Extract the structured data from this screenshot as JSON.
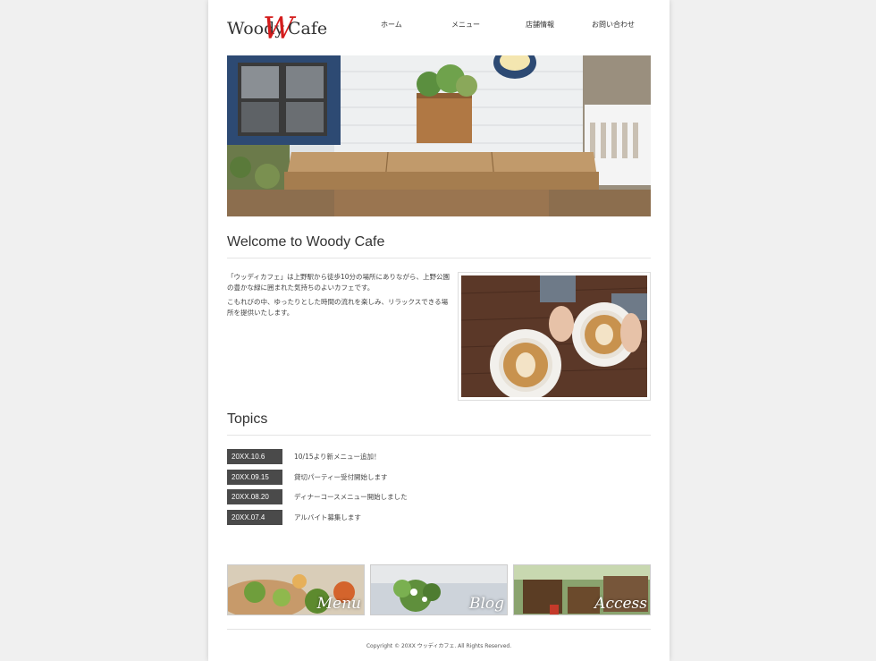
{
  "logo": {
    "part1": "Woody",
    "big_letter": "W",
    "part2": "Cafe"
  },
  "nav": [
    {
      "label": "ホーム"
    },
    {
      "label": "メニュー"
    },
    {
      "label": "店舗情報"
    },
    {
      "label": "お問い合わせ"
    }
  ],
  "welcome": {
    "title": "Welcome to Woody Cafe",
    "paragraphs": [
      "「ウッディカフェ」は上野駅から徒歩10分の場所にありながら、上野公園の豊かな緑に囲まれた気持ちのよいカフェです。",
      "こもれびの中、ゆったりとした時間の流れを楽しみ、リラックスできる場所を提供いたします。"
    ]
  },
  "topics": {
    "title": "Topics",
    "items": [
      {
        "date": "20XX.10.6",
        "text": "10/15より新メニュー追加！"
      },
      {
        "date": "20XX.09.15",
        "text": "貸切パーティー受付開始します"
      },
      {
        "date": "20XX.08.20",
        "text": "ディナーコースメニュー開始しました"
      },
      {
        "date": "20XX.07.4",
        "text": "アルバイト募集します"
      }
    ]
  },
  "banners": [
    {
      "label": "Menu"
    },
    {
      "label": "Blog"
    },
    {
      "label": "Access"
    }
  ],
  "footer": {
    "copyright": "Copyright © 20XX ウッディカフェ. All Rights Reserved."
  },
  "colors": {
    "logo_accent": "#d41c1c",
    "topic_date_bg": "#4a4a4a"
  }
}
